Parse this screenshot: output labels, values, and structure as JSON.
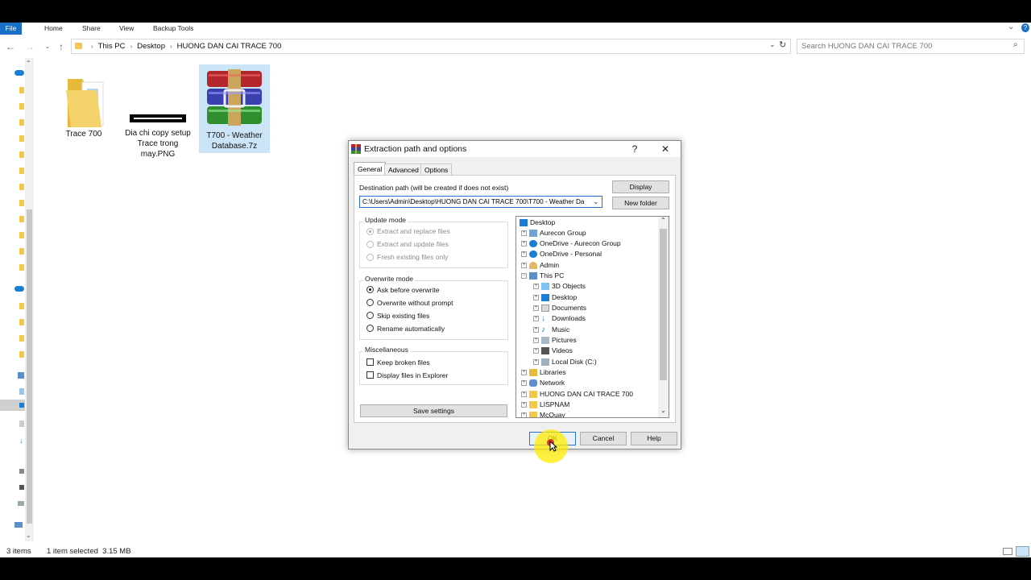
{
  "ribbon": {
    "tabs": [
      "File",
      "Home",
      "Share",
      "View",
      "Backup Tools"
    ]
  },
  "address": {
    "crumbs": [
      "This PC",
      "Desktop",
      "HUONG DAN CAI TRACE 700"
    ]
  },
  "search": {
    "placeholder": "Search HUONG DAN CAI TRACE 700"
  },
  "files": [
    {
      "name": "Trace 700"
    },
    {
      "name": "Dia chi copy setup Trace trong may.PNG"
    },
    {
      "name": "T700 - Weather Database.7z"
    }
  ],
  "status": {
    "count": "3 items",
    "selection": "1 item selected  3.15 MB"
  },
  "dialog": {
    "title": "Extraction path and options",
    "help_label": "?",
    "close_label": "✕",
    "tabs": [
      "General",
      "Advanced",
      "Options"
    ],
    "dest_label": "Destination path (will be created if does not exist)",
    "dest_value": "C:\\Users\\Admin\\Desktop\\HUONG DAN CAI TRACE 700\\T700 - Weather Da",
    "display_label": "Display",
    "newfolder_label": "New folder",
    "update_mode": {
      "title": "Update mode",
      "options": [
        "Extract and replace files",
        "Extract and update files",
        "Fresh existing files only"
      ],
      "selected": 0
    },
    "overwrite_mode": {
      "title": "Overwrite mode",
      "options": [
        "Ask before overwrite",
        "Overwrite without prompt",
        "Skip existing files",
        "Rename automatically"
      ],
      "selected": 0
    },
    "misc": {
      "title": "Miscellaneous",
      "options": [
        "Keep broken files",
        "Display files in Explorer"
      ]
    },
    "save_label": "Save settings",
    "ok_label": "OK",
    "cancel_label": "Cancel",
    "help_btn_label": "Help",
    "tree": [
      "Desktop",
      "Aurecon Group",
      "OneDrive - Aurecon Group",
      "OneDrive - Personal",
      "Admin",
      "This PC",
      "3D Objects",
      "Desktop",
      "Documents",
      "Downloads",
      "Music",
      "Pictures",
      "Videos",
      "Local Disk (C:)",
      "Libraries",
      "Network",
      "HUONG DAN CAI TRACE 700",
      "LISPNAM",
      "McQuay"
    ]
  },
  "colors": {
    "accent": "#1a6fc9",
    "selection": "#cce4f7",
    "cursor_highlight": "#ffeb00"
  }
}
